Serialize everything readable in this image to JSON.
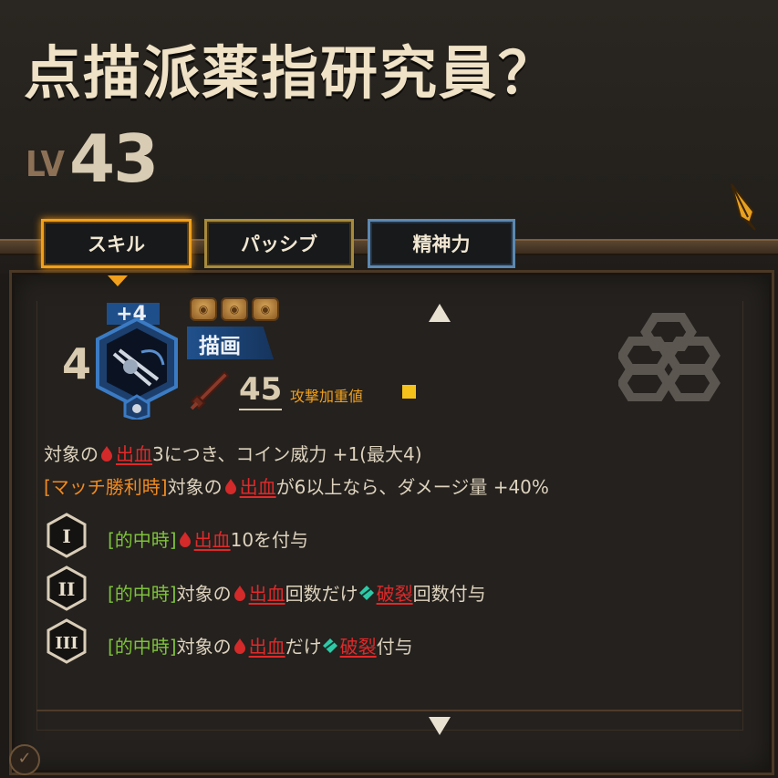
{
  "header": {
    "title": "点描派薬指研究員？",
    "level_label": "LV",
    "level_value": "43"
  },
  "tabs": [
    {
      "label": "スキル",
      "active": true
    },
    {
      "label": "パッシブ",
      "active": false
    },
    {
      "label": "精神力",
      "active": false
    }
  ],
  "skill": {
    "count": "4",
    "upgrade": "+4",
    "name": "描画",
    "power": "45",
    "weight_label": "攻撃加重値",
    "weight_color": "#f4c21a",
    "affinity_color": "#20508c",
    "icon": "drawing-skill-icon"
  },
  "description": {
    "line1_prefix": "対象の",
    "line1_kw": "出血",
    "line1_suffix": "3につき、コイン威力 +1(最大4)",
    "line2_tag": "[マッチ勝利時]",
    "line2_prefix": " 対象の",
    "line2_kw": "出血",
    "line2_suffix": "が6以上なら、ダメージ量 +40%"
  },
  "coins": [
    {
      "numeral": "I",
      "tag": "[的中時]",
      "prefix": " ",
      "kw1": "出血",
      "mid": "10を付与",
      "kw2": "",
      "suffix": ""
    },
    {
      "numeral": "II",
      "tag": "[的中時]",
      "prefix": " 対象の",
      "kw1": "出血",
      "mid": "回数だけ",
      "kw2": "破裂",
      "suffix": "回数付与"
    },
    {
      "numeral": "III",
      "tag": "[的中時]",
      "prefix": " 対象の",
      "kw1": "出血",
      "mid": "だけ",
      "kw2": "破裂",
      "suffix": "付与"
    }
  ]
}
